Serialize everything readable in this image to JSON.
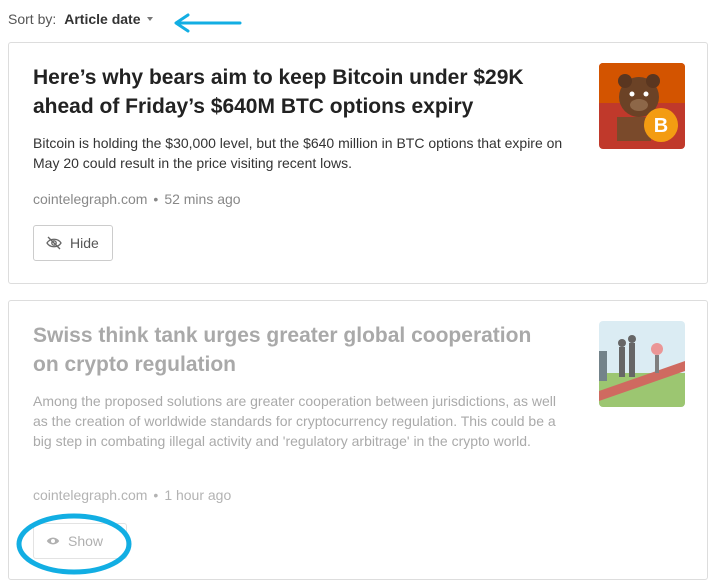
{
  "sort": {
    "label": "Sort by:",
    "value": "Article date"
  },
  "articles": [
    {
      "headline": "Here’s why bears aim to keep Bitcoin under $29K ahead of Friday’s $640M BTC options expiry",
      "summary": "Bitcoin is holding the $30,000 level, but the $640 million in BTC options that expire on May 20 could result in the price visiting recent lows.",
      "source": "cointelegraph.com",
      "time": "52 mins ago",
      "action_label": "Hide",
      "action_icon": "eye-slash-icon",
      "thumbnail": "bear-bitcoin-illustration"
    },
    {
      "headline": "Swiss think tank urges greater global cooperation on crypto regulation",
      "summary": "Among the proposed solutions are greater cooperation between jurisdictions, as well as the creation of worldwide standards for cryptocurrency regulation. This could be a big step in combating illegal activity and 'regulatory arbitrage' in the crypto world.",
      "source": "cointelegraph.com",
      "time": "1 hour ago",
      "action_label": "Show",
      "action_icon": "eye-icon",
      "thumbnail": "swiss-regulation-illustration"
    }
  ],
  "colors": {
    "annotation": "#12aee3",
    "hidden_text": "#a9a9a9",
    "border": "#dddddd"
  }
}
